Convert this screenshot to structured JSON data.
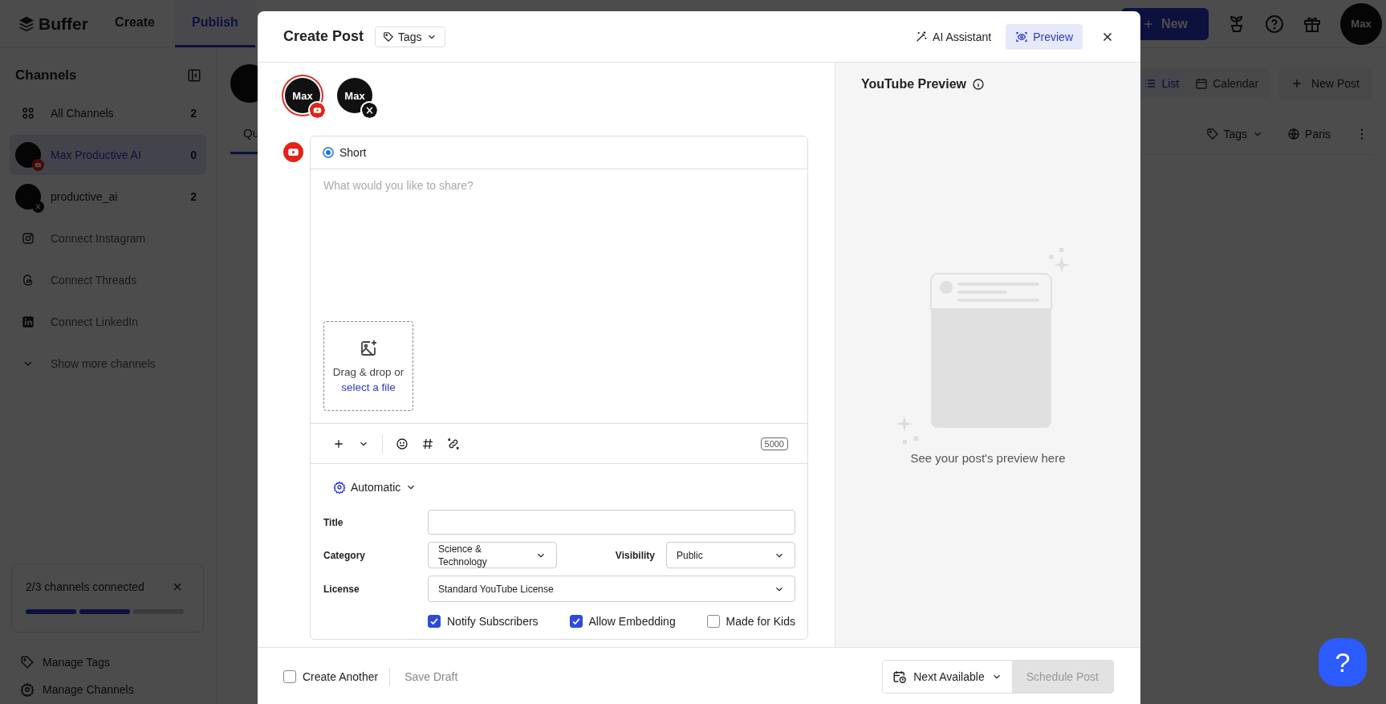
{
  "app": {
    "logo": "Buffer",
    "nav": [
      {
        "label": "Create",
        "selected": false
      },
      {
        "label": "Publish",
        "selected": true
      }
    ],
    "new_button": "New",
    "avatar": "Max"
  },
  "sidebar": {
    "title": "Channels",
    "items": [
      {
        "kind": "all",
        "label": "All Channels",
        "count": "2",
        "selected": false
      },
      {
        "kind": "youtube",
        "label": "Max Productive AI",
        "count": "0",
        "selected": true
      },
      {
        "kind": "x",
        "label": "productive_ai",
        "count": "2",
        "selected": false
      },
      {
        "kind": "instagram",
        "label": "Connect Instagram"
      },
      {
        "kind": "threads",
        "label": "Connect Threads"
      },
      {
        "kind": "linkedin",
        "label": "Connect LinkedIn"
      },
      {
        "kind": "more",
        "label": "Show more channels"
      }
    ],
    "progress_card": {
      "text": "2/3 channels connected",
      "steps": [
        {
          "done": true
        },
        {
          "done": true
        },
        {
          "done": false
        }
      ]
    },
    "links": [
      {
        "kind": "tag",
        "label": "Manage Tags"
      },
      {
        "kind": "gear",
        "label": "Manage Channels"
      }
    ]
  },
  "main": {
    "tabs": [
      {
        "label": "Qu",
        "selected": true
      }
    ],
    "view_toggle": [
      {
        "kind": "list",
        "label": "List",
        "selected": true
      },
      {
        "kind": "calendar",
        "label": "Calendar",
        "selected": false
      }
    ],
    "new_post": "New Post",
    "filters": [
      {
        "kind": "tags",
        "label": "Tags"
      },
      {
        "kind": "timezone",
        "label": "Paris"
      }
    ]
  },
  "modal": {
    "title": "Create Post",
    "tags_button": "Tags",
    "ai_button": "AI Assistant",
    "preview_button": {
      "label": "Preview",
      "selected": true
    },
    "channels": [
      {
        "kind": "youtube",
        "avatar": "Max",
        "selected": true
      },
      {
        "kind": "x",
        "avatar": "Max",
        "selected": false
      }
    ],
    "post_types": [
      {
        "label": "Short",
        "selected": true
      }
    ],
    "composer": {
      "placeholder": "What would you like to share?",
      "dropzone_text": "Drag & drop or",
      "dropzone_link": "select a file",
      "char_count": "5000"
    },
    "settings": {
      "mode": "Automatic",
      "rows": [
        {
          "fields": [
            {
              "kind": "input",
              "label": "Title"
            }
          ]
        },
        {
          "fields": [
            {
              "kind": "select",
              "label": "Category",
              "value": "Science & Technology"
            },
            {
              "kind": "select",
              "label": "Visibility",
              "value": "Public"
            }
          ]
        },
        {
          "fields": [
            {
              "kind": "select",
              "label": "License",
              "value": "Standard YouTube License"
            }
          ]
        }
      ],
      "options": [
        {
          "label": "Notify Subscribers",
          "checked": true
        },
        {
          "label": "Allow Embedding",
          "checked": true
        },
        {
          "label": "Made for Kids",
          "checked": false
        }
      ]
    },
    "preview": {
      "title": "YouTube Preview",
      "empty_text": "See your post's preview here"
    },
    "footer": {
      "create_another": {
        "label": "Create Another",
        "checked": false
      },
      "save_draft": "Save Draft",
      "schedule_mode": "Next Available",
      "schedule_button": {
        "label": "Schedule Post",
        "disabled": true
      }
    }
  },
  "help_button": "?"
}
